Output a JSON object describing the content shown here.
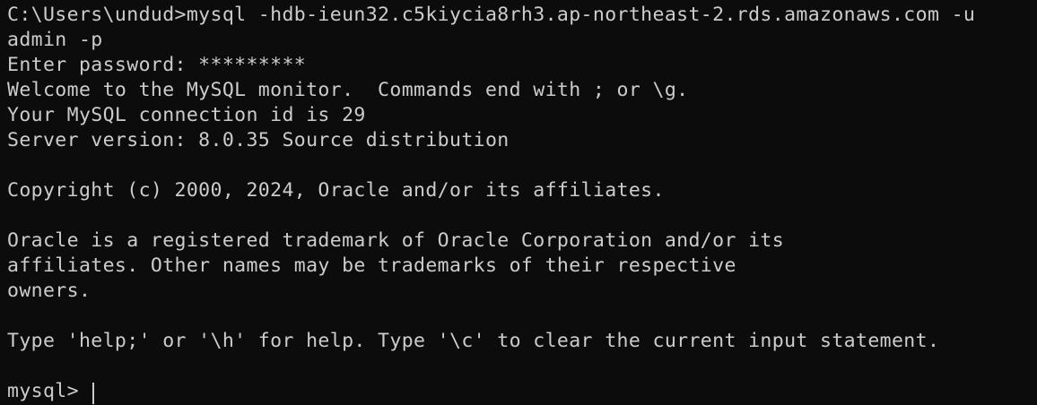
{
  "terminal": {
    "lines": {
      "l0": "C:\\Users\\undud>mysql -hdb-ieun32.c5kiycia8rh3.ap-northeast-2.rds.amazonaws.com -u",
      "l1": "admin -p",
      "l2": "Enter password: *********",
      "l3": "Welcome to the MySQL monitor.  Commands end with ; or \\g.",
      "l4": "Your MySQL connection id is 29",
      "l5": "Server version: 8.0.35 Source distribution",
      "l7": "Copyright (c) 2000, 2024, Oracle and/or its affiliates.",
      "l9": "Oracle is a registered trademark of Oracle Corporation and/or its",
      "l10": "affiliates. Other names may be trademarks of their respective",
      "l11": "owners.",
      "l13": "Type 'help;' or '\\h' for help. Type '\\c' to clear the current input statement."
    },
    "prompt": "mysql> "
  }
}
